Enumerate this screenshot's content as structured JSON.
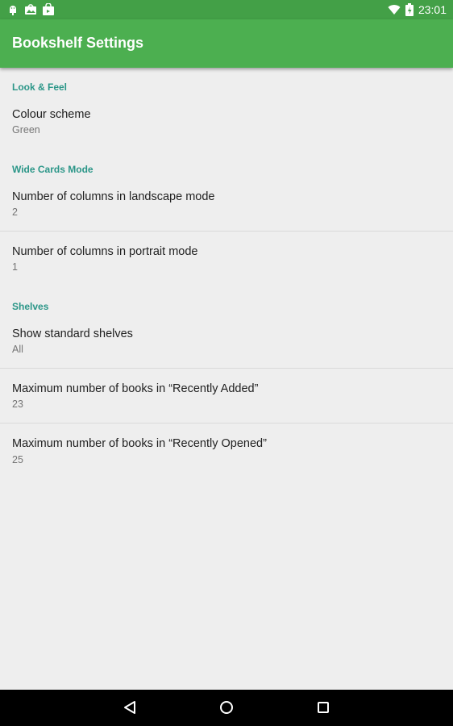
{
  "status_bar": {
    "time": "23:01",
    "icons": [
      "android-debug-icon",
      "image-notification-icon",
      "store-notification-icon",
      "wifi-icon",
      "battery-icon"
    ]
  },
  "app_bar": {
    "title": "Bookshelf Settings",
    "color": "#4caf50"
  },
  "sections": {
    "look_and_feel": {
      "header": "Look & Feel",
      "items": [
        {
          "title": "Colour scheme",
          "summary": "Green"
        }
      ]
    },
    "wide_cards": {
      "header": "Wide Cards Mode",
      "items": [
        {
          "title": "Number of columns in landscape mode",
          "summary": "2"
        },
        {
          "title": "Number of columns in portrait mode",
          "summary": "1"
        }
      ]
    },
    "shelves": {
      "header": "Shelves",
      "items": [
        {
          "title": "Show standard shelves",
          "summary": "All"
        },
        {
          "title": "Maximum number of books in “Recently Added”",
          "summary": "23"
        },
        {
          "title": "Maximum number of books in “Recently Opened”",
          "summary": "25"
        }
      ]
    }
  },
  "colors": {
    "accent_header": "#2b9688",
    "status_bar": "#43a047"
  },
  "nav_bar": {
    "buttons": [
      "back-icon",
      "home-icon",
      "recents-icon"
    ]
  }
}
